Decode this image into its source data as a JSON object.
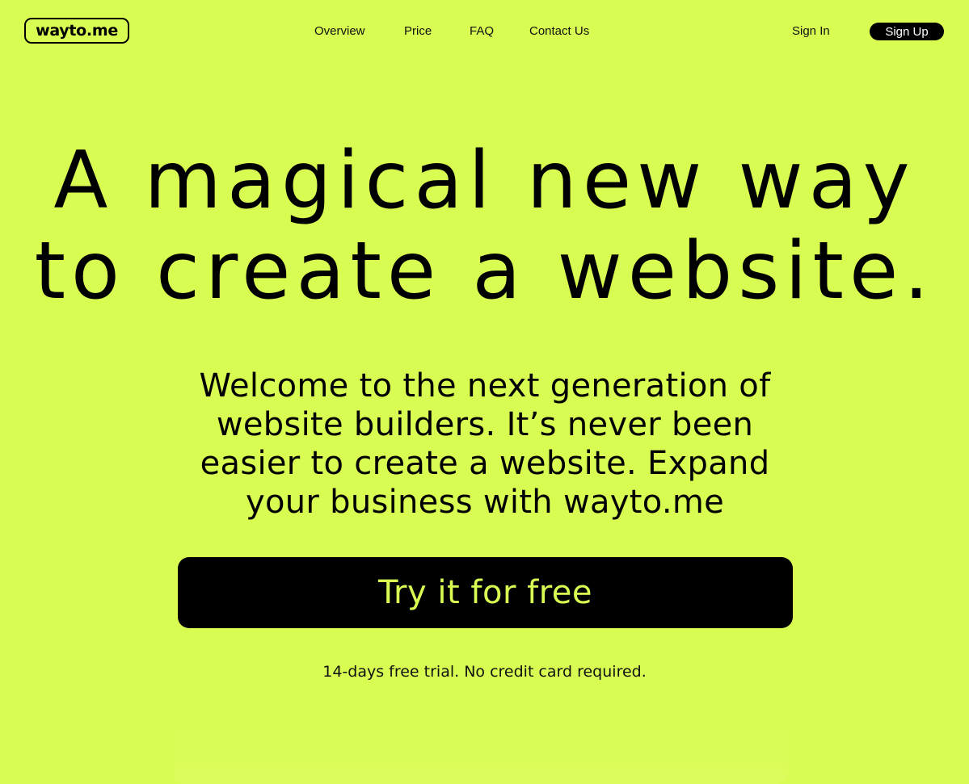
{
  "brand": {
    "logo_text": "wayto.me"
  },
  "nav": {
    "links": [
      "Overview",
      "Price",
      "FAQ",
      "Contact Us"
    ],
    "sign_in": "Sign In",
    "sign_up": "Sign Up"
  },
  "hero": {
    "headline_lines": [
      "A magical new way",
      "to create a website."
    ],
    "subtitle_lines": [
      "Welcome to the next generation of",
      "website builders. It’s never been",
      "easier to create a website. Expand",
      "your business with wayto.me"
    ],
    "cta_label": "Try it for free",
    "note": "14-days free trial. No credit card required."
  },
  "colors": {
    "background": "#d8fc52",
    "text": "#000000",
    "cta_text": "#d8fc52"
  }
}
